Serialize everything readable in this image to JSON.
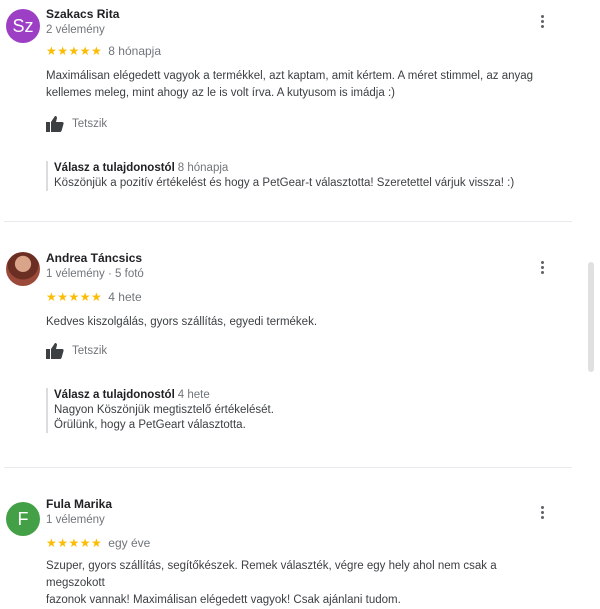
{
  "reviews": [
    {
      "avatar_letter": "Sz",
      "avatar_color": "#9c3fc4",
      "name": "Szakacs Rita",
      "meta": "2 vélemény",
      "stars": "★★★★★",
      "rating": 5,
      "when": "8 hónapja",
      "text": "Maximálisan elégedett vagyok a termékkel, azt kaptam, amit kértem. A méret stimmel, az anyag\nkellemes meleg, mint ahogy az le is volt írva. A kutyusom is imádja :)",
      "like_label": "Tetszik",
      "reply_label": "Válasz a tulajdonostól",
      "reply_when": "8 hónapja",
      "reply_text": "Köszönjük a pozitív értékelést és hogy a PetGear-t választotta! Szeretettel várjuk vissza! :)"
    },
    {
      "avatar_letter": "",
      "avatar_color": "",
      "name": "Andrea Táncsics",
      "meta": "1 vélemény · 5 fotó",
      "stars": "★★★★★",
      "rating": 5,
      "when": "4 hete",
      "text": "Kedves kiszolgálás, gyors szállítás, egyedi termékek.",
      "like_label": "Tetszik",
      "reply_label": "Válasz a tulajdonostól",
      "reply_when": "4 hete",
      "reply_text": "Nagyon Köszönjük megtisztelő értékelését.\nÖrülünk, hogy a PetGeart választotta."
    },
    {
      "avatar_letter": "F",
      "avatar_color": "#43a047",
      "name": "Fula Marika",
      "meta": "1 vélemény",
      "stars": "★★★★★",
      "rating": 5,
      "when": "egy éve",
      "text": "Szuper, gyors szállítás, segítőkészek. Remek választék, végre egy hely ahol nem csak a megszokott\nfazonok vannak! Maximálisan elégedett vagyok! Csak ajánlani tudom."
    }
  ],
  "icons": {
    "more": "more-vert-icon",
    "like": "thumb-up-icon",
    "star": "star-icon"
  },
  "colors": {
    "star": "#fbbc04",
    "muted": "#70757a"
  }
}
